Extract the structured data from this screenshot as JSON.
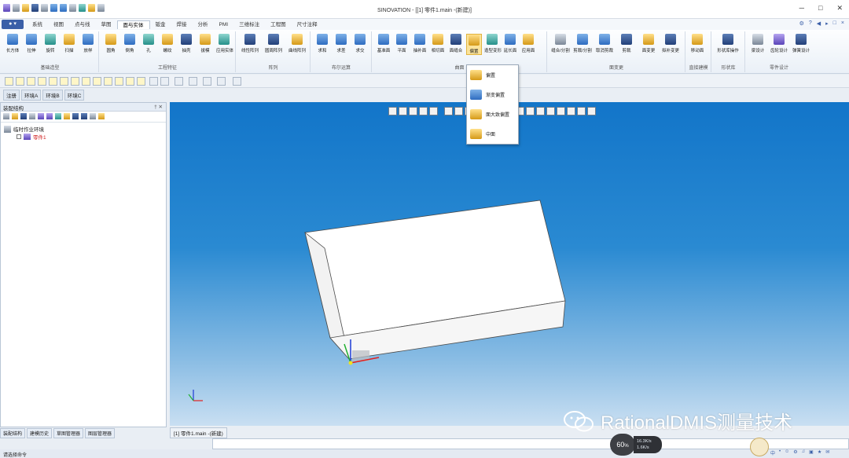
{
  "app": {
    "title": "SINOVATION - [[1] 零件1.main -(新建)]",
    "menu_label": "● ▾"
  },
  "tabs": [
    "系统",
    "视图",
    "点与线",
    "草图",
    "面与实体",
    "钣金",
    "焊接",
    "分析",
    "PMI",
    "三维标注",
    "工程图",
    "尺寸注释"
  ],
  "active_tab": "面与实体",
  "tabrow_right": [
    "⚙",
    "?",
    "◀",
    "▸",
    "□",
    "×"
  ],
  "window_controls": [
    "─",
    "□",
    "✕"
  ],
  "ribbon": {
    "groups": [
      {
        "title": "基础造型",
        "buttons": [
          "长方体",
          "拉伸",
          "旋转",
          "扫描",
          "放样"
        ]
      },
      {
        "title": "工程特征",
        "buttons": [
          "圆角",
          "倒角",
          "孔",
          "螺纹",
          "抽壳",
          "拔模",
          "应用实体"
        ]
      },
      {
        "title": "阵列",
        "buttons": [
          "线性阵列",
          "圆周阵列",
          "曲线阵列"
        ]
      },
      {
        "title": "布尔运算",
        "buttons": [
          "求和",
          "求差",
          "求交"
        ]
      },
      {
        "title": "曲面",
        "buttons": [
          "基准面",
          "平面",
          "抽补面",
          "相切面",
          "面缝合",
          "偏置",
          "造型变形",
          "延长面",
          "应用面"
        ]
      },
      {
        "title": "面变更",
        "buttons": [
          "缝合/分割",
          "剪裁/分割",
          "取消剪裁",
          "剪裁",
          "面变更",
          "拟补变更"
        ]
      },
      {
        "title": "直接建模",
        "buttons": [
          "移动面"
        ]
      },
      {
        "title": "形状库",
        "buttons": [
          "形状库操作"
        ]
      },
      {
        "title": "零件设计",
        "buttons": [
          "梁设计",
          "齿轮设计",
          "弹簧设计"
        ]
      }
    ]
  },
  "dropdown": {
    "items": [
      "偏置",
      "渐变偏置",
      "面大致偏置",
      "中面"
    ]
  },
  "env_tabs": [
    "注册",
    "环境A",
    "环境B",
    "环境C"
  ],
  "left_panel": {
    "title": "装配结构",
    "tree_root": "临时作业环境",
    "tree_child": "零件1"
  },
  "left_bottom_tabs": [
    "装配结构",
    "建模历史",
    "草图管理器",
    "图层管理器"
  ],
  "doc_tab": "[1] 零件1.main -(新建)",
  "status": {
    "left_text": "请选择命令",
    "fps": "60",
    "fps_unit": "%",
    "net_up": "16.3K/s",
    "net_down": "1.6K/s"
  },
  "tray": [
    "中",
    "•",
    "☺",
    "⚙",
    "♫",
    "▣",
    "★",
    "✉"
  ],
  "watermark": "RationalDMIS测量技术",
  "colors": {
    "accent": "#3a5fa8",
    "viewport_top": "#1275c9",
    "viewport_bottom": "#c9dff2",
    "part_face": "#ffffff"
  }
}
